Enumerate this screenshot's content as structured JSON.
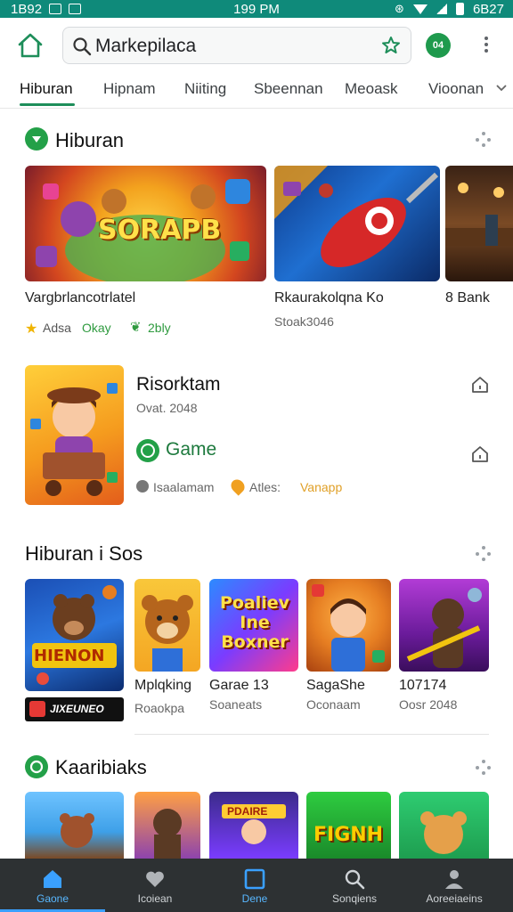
{
  "status_bar": {
    "left_text": "1B92",
    "time": "199 PM",
    "right_text": "6B27"
  },
  "search": {
    "value": "Markepilaca"
  },
  "header": {
    "badge": "04"
  },
  "tabs": [
    "Hiburan",
    "Hipnam",
    "Niiting",
    "Sbeennan",
    "Meoask",
    "Vioonan"
  ],
  "section1": {
    "title": "Hiburan",
    "card1": {
      "art_text": "SORAPB",
      "title": "Vargbrlancotrlatel",
      "rating": "Adsa",
      "badge1": "Okay",
      "badge2": "2bly"
    },
    "card2": {
      "title": "Rkaurakolqna Ko",
      "subtitle": "Stoak3046"
    },
    "card3": {
      "title": "8 Bank"
    }
  },
  "feature": {
    "title": "Risorktam",
    "date": "Ovat. 2048",
    "game_label": "Game",
    "meta1": "Isaalamam",
    "meta2": "Atles:",
    "meta3": "Vanapp"
  },
  "section2": {
    "title": "Hiburan i Sos",
    "cards": [
      {
        "art_text": "HIENON",
        "banner": "JIXEUNEO"
      },
      {
        "title": "Mplqking",
        "subtitle": "Roaokpa"
      },
      {
        "art_text": "Poaliev Ine Boxner",
        "title": "Garae 13",
        "subtitle": "Soaneats"
      },
      {
        "title": "SagaShe",
        "subtitle": "Oconaam"
      },
      {
        "title": "107174",
        "subtitle": "Oosr 2048"
      }
    ]
  },
  "section3": {
    "title": "Kaaribiaks",
    "cards": [
      {
        "art_text": ""
      },
      {
        "art_text": ""
      },
      {
        "art_text": "PDAIRE"
      },
      {
        "art_text": "FIGNH"
      },
      {
        "art_text": ""
      }
    ]
  },
  "bottom_nav": [
    {
      "label": "Gaone",
      "icon": "home-icon"
    },
    {
      "label": "Icoiean",
      "icon": "heart-icon"
    },
    {
      "label": "Dene",
      "icon": "square-icon"
    },
    {
      "label": "Sonqiens",
      "icon": "search-icon"
    },
    {
      "label": "Aoreeiaeins",
      "icon": "person-icon"
    }
  ],
  "colors": {
    "status_bar": "#0f8a7a",
    "accent_green": "#1e8e5a",
    "nav_bg": "#2d3133",
    "nav_active": "#58b7ff"
  }
}
